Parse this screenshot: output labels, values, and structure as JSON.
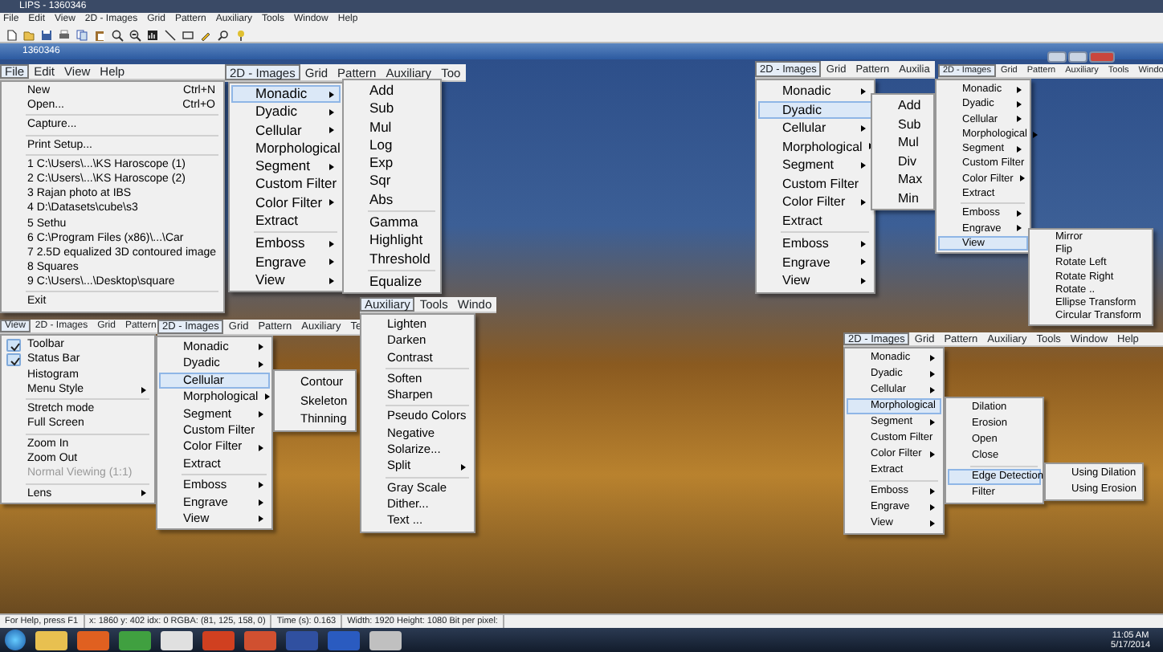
{
  "app": {
    "title": "LIPS - 1360346",
    "menu": [
      "File",
      "Edit",
      "View",
      "2D - Images",
      "Grid",
      "Pattern",
      "Auxiliary",
      "Tools",
      "Window",
      "Help"
    ]
  },
  "document": {
    "title": "1360346"
  },
  "clusters": [
    {
      "menubar": [
        {
          "label": "File",
          "selected": true
        },
        {
          "label": "Edit",
          "selected": false
        },
        {
          "label": "View",
          "selected": false
        },
        {
          "label": "Help",
          "selected": false
        }
      ],
      "menus": [
        {
          "items": [
            {
              "kind": "item",
              "label": "New",
              "shortcut": "Ctrl+N",
              "submenu": false,
              "selected": false
            },
            {
              "kind": "item",
              "label": "Open...",
              "shortcut": "Ctrl+O",
              "submenu": false,
              "selected": false
            },
            {
              "kind": "separator"
            },
            {
              "kind": "item",
              "label": "Capture...",
              "submenu": false,
              "selected": false
            },
            {
              "kind": "separator"
            },
            {
              "kind": "item",
              "label": "Print Setup...",
              "submenu": false,
              "selected": false
            },
            {
              "kind": "separator"
            },
            {
              "kind": "item",
              "label": "1 C:\\Users\\...\\KS Haroscope (1)",
              "submenu": false,
              "selected": false
            },
            {
              "kind": "item",
              "label": "2 C:\\Users\\...\\KS Haroscope (2)",
              "submenu": false,
              "selected": false
            },
            {
              "kind": "item",
              "label": "3 Rajan photo at IBS",
              "submenu": false,
              "selected": false
            },
            {
              "kind": "item",
              "label": "4 D:\\Datasets\\cube\\s3",
              "submenu": false,
              "selected": false
            },
            {
              "kind": "item",
              "label": "5 Sethu",
              "submenu": false,
              "selected": false
            },
            {
              "kind": "item",
              "label": "6 C:\\Program Files (x86)\\...\\Car",
              "submenu": false,
              "selected": false
            },
            {
              "kind": "item",
              "label": "7 2.5D equalized 3D contoured image",
              "submenu": false,
              "selected": false
            },
            {
              "kind": "item",
              "label": "8 Squares",
              "submenu": false,
              "selected": false
            },
            {
              "kind": "item",
              "label": "9 C:\\Users\\...\\Desktop\\square",
              "submenu": false,
              "selected": false
            },
            {
              "kind": "separator"
            },
            {
              "kind": "item",
              "label": "Exit",
              "submenu": false,
              "selected": false
            }
          ]
        }
      ]
    },
    {
      "menubar": [
        {
          "label": "View",
          "selected": true
        },
        {
          "label": "2D - Images",
          "selected": false
        },
        {
          "label": "Grid",
          "selected": false
        },
        {
          "label": "Pattern",
          "selected": false
        }
      ],
      "menus": [
        {
          "items": [
            {
              "kind": "item",
              "label": "Toolbar",
              "submenu": false,
              "selected": false,
              "checked": true,
              "disabled": false
            },
            {
              "kind": "item",
              "label": "Status Bar",
              "submenu": false,
              "selected": false,
              "checked": true,
              "disabled": false
            },
            {
              "kind": "item",
              "label": "Histogram",
              "submenu": false,
              "selected": false,
              "checked": false,
              "disabled": false
            },
            {
              "kind": "item",
              "label": "Menu Style",
              "submenu": true,
              "selected": false,
              "checked": false,
              "disabled": false
            },
            {
              "kind": "separator"
            },
            {
              "kind": "item",
              "label": "Stretch mode",
              "submenu": false,
              "selected": false,
              "checked": false,
              "disabled": false
            },
            {
              "kind": "item",
              "label": "Full Screen",
              "submenu": false,
              "selected": false,
              "checked": false,
              "disabled": false
            },
            {
              "kind": "separator"
            },
            {
              "kind": "item",
              "label": "Zoom In",
              "submenu": false,
              "selected": false,
              "checked": false,
              "disabled": false
            },
            {
              "kind": "item",
              "label": "Zoom Out",
              "submenu": false,
              "selected": false,
              "checked": false,
              "disabled": false
            },
            {
              "kind": "item",
              "label": "Normal Viewing (1:1)",
              "submenu": false,
              "selected": false,
              "checked": false,
              "disabled": true
            },
            {
              "kind": "separator"
            },
            {
              "kind": "item",
              "label": "Lens",
              "submenu": true,
              "selected": false,
              "checked": false,
              "disabled": false
            }
          ]
        }
      ]
    },
    {
      "menubar": [
        {
          "label": "2D - Images",
          "selected": true
        },
        {
          "label": "Grid",
          "selected": false
        },
        {
          "label": "Pattern",
          "selected": false
        },
        {
          "label": "Auxiliary",
          "selected": false
        },
        {
          "label": "Te",
          "selected": false
        }
      ],
      "menus": [
        {
          "items": [
            {
              "kind": "item",
              "label": "Monadic",
              "submenu": true,
              "selected": false
            },
            {
              "kind": "item",
              "label": "Dyadic",
              "submenu": true,
              "selected": false
            },
            {
              "kind": "item",
              "label": "Cellular",
              "submenu": false,
              "selected": true
            },
            {
              "kind": "item",
              "label": "Morphological",
              "submenu": true,
              "selected": false
            },
            {
              "kind": "item",
              "label": "Segment",
              "submenu": true,
              "selected": false
            },
            {
              "kind": "item",
              "label": "Custom Filter",
              "submenu": false,
              "selected": false
            },
            {
              "kind": "item",
              "label": "Color Filter",
              "submenu": true,
              "selected": false
            },
            {
              "kind": "item",
              "label": "Extract",
              "submenu": false,
              "selected": false
            },
            {
              "kind": "separator"
            },
            {
              "kind": "item",
              "label": "Emboss",
              "submenu": true,
              "selected": false
            },
            {
              "kind": "item",
              "label": "Engrave",
              "submenu": true,
              "selected": false
            },
            {
              "kind": "item",
              "label": "View",
              "submenu": true,
              "selected": false
            }
          ]
        },
        {
          "items": [
            {
              "kind": "item",
              "label": "Contour",
              "submenu": false,
              "selected": false
            },
            {
              "kind": "item",
              "label": "Skeleton",
              "submenu": false,
              "selected": false
            },
            {
              "kind": "item",
              "label": "Thinning",
              "submenu": false,
              "selected": false
            }
          ]
        }
      ]
    },
    {
      "menubar": [
        {
          "label": "2D - Images",
          "selected": true
        },
        {
          "label": "Grid",
          "selected": false
        },
        {
          "label": "Pattern",
          "selected": false
        },
        {
          "label": "Auxiliary",
          "selected": false
        },
        {
          "label": "Too",
          "selected": false
        }
      ],
      "menus": [
        {
          "items": [
            {
              "kind": "item",
              "label": "Monadic",
              "submenu": true,
              "selected": true
            },
            {
              "kind": "item",
              "label": "Dyadic",
              "submenu": true,
              "selected": false
            },
            {
              "kind": "item",
              "label": "Cellular",
              "submenu": true,
              "selected": false
            },
            {
              "kind": "item",
              "label": "Morphological",
              "submenu": true,
              "selected": false
            },
            {
              "kind": "item",
              "label": "Segment",
              "submenu": true,
              "selected": false
            },
            {
              "kind": "item",
              "label": "Custom Filter",
              "submenu": false,
              "selected": false
            },
            {
              "kind": "item",
              "label": "Color Filter",
              "submenu": true,
              "selected": false
            },
            {
              "kind": "item",
              "label": "Extract",
              "submenu": false,
              "selected": false
            },
            {
              "kind": "separator"
            },
            {
              "kind": "item",
              "label": "Emboss",
              "submenu": true,
              "selected": false
            },
            {
              "kind": "item",
              "label": "Engrave",
              "submenu": true,
              "selected": false
            },
            {
              "kind": "item",
              "label": "View",
              "submenu": true,
              "selected": false
            }
          ]
        },
        {
          "items": [
            {
              "kind": "item",
              "label": "Add",
              "submenu": false,
              "selected": false
            },
            {
              "kind": "item",
              "label": "Sub",
              "submenu": false,
              "selected": false
            },
            {
              "kind": "item",
              "label": "Mul",
              "submenu": false,
              "selected": false
            },
            {
              "kind": "item",
              "label": "Log",
              "submenu": false,
              "selected": false
            },
            {
              "kind": "item",
              "label": "Exp",
              "submenu": false,
              "selected": false
            },
            {
              "kind": "item",
              "label": "Sqr",
              "submenu": false,
              "selected": false
            },
            {
              "kind": "item",
              "label": "Abs",
              "submenu": false,
              "selected": false
            },
            {
              "kind": "separator"
            },
            {
              "kind": "item",
              "label": "Gamma",
              "submenu": false,
              "selected": false
            },
            {
              "kind": "item",
              "label": "Highlight",
              "submenu": false,
              "selected": false
            },
            {
              "kind": "item",
              "label": "Threshold",
              "submenu": false,
              "selected": false
            },
            {
              "kind": "separator"
            },
            {
              "kind": "item",
              "label": "Equalize",
              "submenu": false,
              "selected": false
            }
          ]
        }
      ]
    },
    {
      "menubar": [
        {
          "label": "Auxiliary",
          "selected": true
        },
        {
          "label": "Tools",
          "selected": false
        },
        {
          "label": "Windo",
          "selected": false
        }
      ],
      "menus": [
        {
          "items": [
            {
              "kind": "item",
              "label": "Lighten",
              "submenu": false,
              "selected": false
            },
            {
              "kind": "item",
              "label": "Darken",
              "submenu": false,
              "selected": false
            },
            {
              "kind": "item",
              "label": "Contrast",
              "submenu": false,
              "selected": false
            },
            {
              "kind": "separator"
            },
            {
              "kind": "item",
              "label": "Soften",
              "submenu": false,
              "selected": false
            },
            {
              "kind": "item",
              "label": "Sharpen",
              "submenu": false,
              "selected": false
            },
            {
              "kind": "separator"
            },
            {
              "kind": "item",
              "label": "Pseudo Colors",
              "submenu": false,
              "selected": false
            },
            {
              "kind": "item",
              "label": "Negative",
              "submenu": false,
              "selected": false
            },
            {
              "kind": "item",
              "label": "Solarize...",
              "submenu": false,
              "selected": false
            },
            {
              "kind": "item",
              "label": "Split",
              "submenu": true,
              "selected": false
            },
            {
              "kind": "separator"
            },
            {
              "kind": "item",
              "label": "Gray Scale",
              "submenu": false,
              "selected": false
            },
            {
              "kind": "item",
              "label": "Dither...",
              "submenu": false,
              "selected": false
            },
            {
              "kind": "item",
              "label": "Text ...",
              "submenu": false,
              "selected": false
            }
          ]
        }
      ]
    },
    {
      "menubar": [
        {
          "label": "2D - Images",
          "selected": true
        },
        {
          "label": "Grid",
          "selected": false
        },
        {
          "label": "Pattern",
          "selected": false
        },
        {
          "label": "Auxilia",
          "selected": false
        }
      ],
      "menus": [
        {
          "items": [
            {
              "kind": "item",
              "label": "Monadic",
              "submenu": true,
              "selected": false
            },
            {
              "kind": "item",
              "label": "Dyadic",
              "submenu": false,
              "selected": true
            },
            {
              "kind": "item",
              "label": "Cellular",
              "submenu": true,
              "selected": false
            },
            {
              "kind": "item",
              "label": "Morphological",
              "submenu": true,
              "selected": false
            },
            {
              "kind": "item",
              "label": "Segment",
              "submenu": true,
              "selected": false
            },
            {
              "kind": "item",
              "label": "Custom Filter",
              "submenu": false,
              "selected": false
            },
            {
              "kind": "item",
              "label": "Color Filter",
              "submenu": true,
              "selected": false
            },
            {
              "kind": "item",
              "label": "Extract",
              "submenu": false,
              "selected": false
            },
            {
              "kind": "separator"
            },
            {
              "kind": "item",
              "label": "Emboss",
              "submenu": true,
              "selected": false
            },
            {
              "kind": "item",
              "label": "Engrave",
              "submenu": true,
              "selected": false
            },
            {
              "kind": "item",
              "label": "View",
              "submenu": true,
              "selected": false
            }
          ]
        },
        {
          "items": [
            {
              "kind": "item",
              "label": "Add",
              "submenu": false,
              "selected": false
            },
            {
              "kind": "item",
              "label": "Sub",
              "submenu": false,
              "selected": false
            },
            {
              "kind": "item",
              "label": "Mul",
              "submenu": false,
              "selected": false
            },
            {
              "kind": "item",
              "label": "Div",
              "submenu": false,
              "selected": false
            },
            {
              "kind": "item",
              "label": "Max",
              "submenu": false,
              "selected": false
            },
            {
              "kind": "item",
              "label": "Min",
              "submenu": false,
              "selected": false
            }
          ]
        }
      ]
    },
    {
      "window_buttons": true,
      "menubar": [
        {
          "label": "2D - Images",
          "selected": true
        },
        {
          "label": "Grid",
          "selected": false
        },
        {
          "label": "Pattern",
          "selected": false
        },
        {
          "label": "Auxiliary",
          "selected": false
        },
        {
          "label": "Tools",
          "selected": false
        },
        {
          "label": "Windo",
          "selected": false
        }
      ],
      "menus": [
        {
          "items": [
            {
              "kind": "item",
              "label": "Monadic",
              "submenu": true,
              "selected": false
            },
            {
              "kind": "item",
              "label": "Dyadic",
              "submenu": true,
              "selected": false
            },
            {
              "kind": "item",
              "label": "Cellular",
              "submenu": true,
              "selected": false
            },
            {
              "kind": "item",
              "label": "Morphological",
              "submenu": true,
              "selected": false
            },
            {
              "kind": "item",
              "label": "Segment",
              "submenu": true,
              "selected": false
            },
            {
              "kind": "item",
              "label": "Custom Filter",
              "submenu": false,
              "selected": false
            },
            {
              "kind": "item",
              "label": "Color Filter",
              "submenu": true,
              "selected": false
            },
            {
              "kind": "item",
              "label": "Extract",
              "submenu": false,
              "selected": false
            },
            {
              "kind": "separator"
            },
            {
              "kind": "item",
              "label": "Emboss",
              "submenu": true,
              "selected": false
            },
            {
              "kind": "item",
              "label": "Engrave",
              "submenu": true,
              "selected": false
            },
            {
              "kind": "item",
              "label": "View",
              "submenu": false,
              "selected": true
            }
          ]
        },
        {
          "items": [
            {
              "kind": "item",
              "label": "Mirror",
              "submenu": false,
              "selected": false
            },
            {
              "kind": "item",
              "label": "Flip",
              "submenu": false,
              "selected": false
            },
            {
              "kind": "item",
              "label": "Rotate Left",
              "submenu": false,
              "selected": false
            },
            {
              "kind": "item",
              "label": "Rotate Right",
              "submenu": false,
              "selected": false
            },
            {
              "kind": "item",
              "label": "Rotate ..",
              "submenu": false,
              "selected": false
            },
            {
              "kind": "item",
              "label": "Ellipse Transform",
              "submenu": false,
              "selected": false
            },
            {
              "kind": "item",
              "label": "Circular Transform",
              "submenu": false,
              "selected": false
            }
          ]
        }
      ]
    },
    {
      "menubar": [
        {
          "label": "2D - Images",
          "selected": true
        },
        {
          "label": "Grid",
          "selected": false
        },
        {
          "label": "Pattern",
          "selected": false
        },
        {
          "label": "Auxiliary",
          "selected": false
        },
        {
          "label": "Tools",
          "selected": false
        },
        {
          "label": "Window",
          "selected": false
        },
        {
          "label": "Help",
          "selected": false
        }
      ],
      "menus": [
        {
          "items": [
            {
              "kind": "item",
              "label": "Monadic",
              "submenu": true,
              "selected": false
            },
            {
              "kind": "item",
              "label": "Dyadic",
              "submenu": true,
              "selected": false
            },
            {
              "kind": "item",
              "label": "Cellular",
              "submenu": true,
              "selected": false
            },
            {
              "kind": "item",
              "label": "Morphological",
              "submenu": false,
              "selected": true
            },
            {
              "kind": "item",
              "label": "Segment",
              "submenu": true,
              "selected": false
            },
            {
              "kind": "item",
              "label": "Custom Filter",
              "submenu": false,
              "selected": false
            },
            {
              "kind": "item",
              "label": "Color Filter",
              "submenu": true,
              "selected": false
            },
            {
              "kind": "item",
              "label": "Extract",
              "submenu": false,
              "selected": false
            },
            {
              "kind": "separator"
            },
            {
              "kind": "item",
              "label": "Emboss",
              "submenu": true,
              "selected": false
            },
            {
              "kind": "item",
              "label": "Engrave",
              "submenu": true,
              "selected": false
            },
            {
              "kind": "item",
              "label": "View",
              "submenu": true,
              "selected": false
            }
          ]
        },
        {
          "items": [
            {
              "kind": "item",
              "label": "Dilation",
              "submenu": false,
              "selected": false
            },
            {
              "kind": "item",
              "label": "Erosion",
              "submenu": false,
              "selected": false
            },
            {
              "kind": "item",
              "label": "Open",
              "submenu": false,
              "selected": false
            },
            {
              "kind": "item",
              "label": "Close",
              "submenu": false,
              "selected": false
            },
            {
              "kind": "separator"
            },
            {
              "kind": "item",
              "label": "Edge Detection",
              "submenu": false,
              "selected": true
            },
            {
              "kind": "item",
              "label": "Filter",
              "submenu": false,
              "selected": false
            }
          ]
        },
        {
          "items": [
            {
              "kind": "item",
              "label": "Using Dilation",
              "submenu": false,
              "selected": false
            },
            {
              "kind": "item",
              "label": "Using Erosion",
              "submenu": false,
              "selected": false
            }
          ]
        }
      ]
    }
  ],
  "status_bar": [
    "For Help, press F1",
    "x: 1860 y: 402  idx: 0  RGBA: (81, 125, 158, 0)",
    "Time (s): 0.163",
    "Width: 1920  Height: 1080  Bit per pixel: "
  ],
  "taskbar": {
    "time": "11:05 AM",
    "date": "5/17/2014"
  }
}
